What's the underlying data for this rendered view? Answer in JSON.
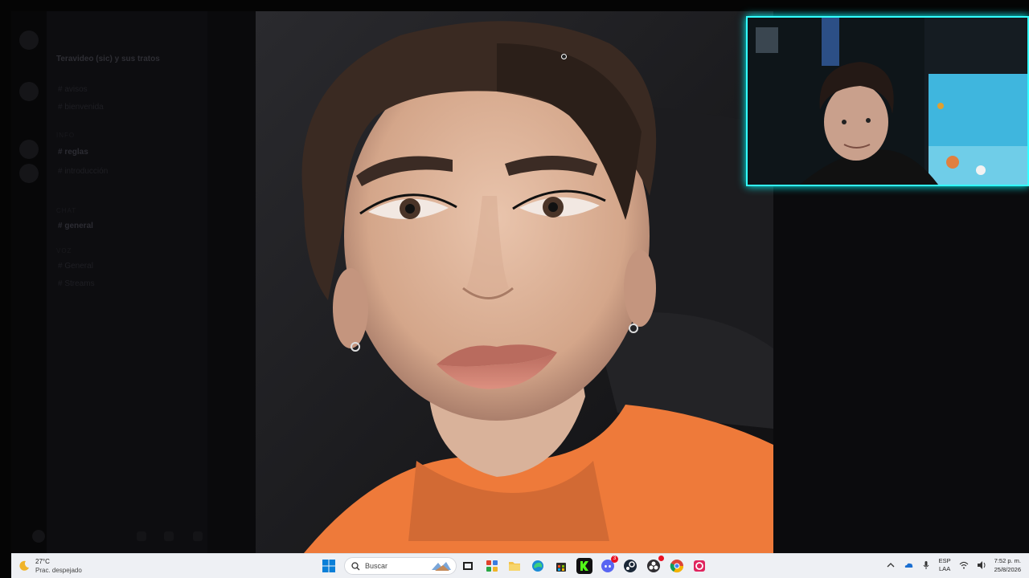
{
  "discord": {
    "server_name": "Teravideo (sic) y sus tratos",
    "channels": [
      {
        "label": "# avisos"
      },
      {
        "label": "# bienvenida"
      },
      {
        "label": "# reglas"
      },
      {
        "label": "# introducción"
      },
      {
        "label": "# general"
      },
      {
        "label": "# clips"
      },
      {
        "label": "# General"
      },
      {
        "label": "# Streams"
      }
    ],
    "categories": [
      "INFO",
      "CHAT",
      "VOZ"
    ]
  },
  "taskbar": {
    "weather": {
      "temp": "27°C",
      "condition": "Prac. despejado"
    },
    "search_placeholder": "Buscar",
    "apps": [
      {
        "icon": "task-view-icon"
      },
      {
        "icon": "widgets-icon"
      },
      {
        "icon": "file-explorer-icon"
      },
      {
        "icon": "edge-icon"
      },
      {
        "icon": "store-icon"
      },
      {
        "icon": "kick-icon"
      },
      {
        "icon": "discord-icon",
        "badge": "3"
      },
      {
        "icon": "steam-icon"
      },
      {
        "icon": "obs-icon"
      },
      {
        "icon": "chrome-icon"
      },
      {
        "icon": "app-red-icon"
      }
    ],
    "lang": {
      "top": "ESP",
      "bottom": "LAA"
    },
    "clock": {
      "time": "7:52 p. m.",
      "date": "25/8/2026"
    }
  },
  "colors": {
    "accent_webcam": "#33ffff",
    "taskbar_bg": "#eef0f4",
    "shirt": "#ee7a3a"
  }
}
